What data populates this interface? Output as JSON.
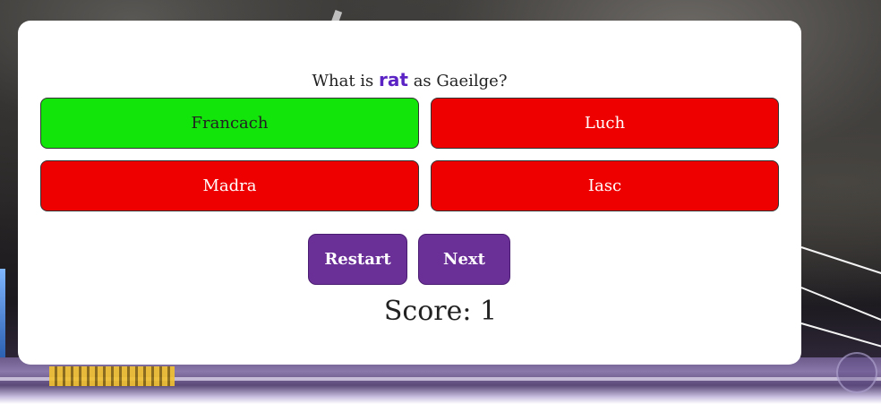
{
  "question": {
    "prefix": "What is",
    "word": "rat",
    "suffix": "as Gaeilge?"
  },
  "answers": [
    {
      "label": "Francach",
      "state": "correct",
      "color": "#12e50a"
    },
    {
      "label": "Luch",
      "state": "incorrect",
      "color": "#ef0000"
    },
    {
      "label": "Madra",
      "state": "incorrect",
      "color": "#ef0000"
    },
    {
      "label": "Iasc",
      "state": "incorrect",
      "color": "#ef0000"
    }
  ],
  "controls": {
    "restart_label": "Restart",
    "next_label": "Next"
  },
  "score": {
    "label": "Score:",
    "value": "1"
  },
  "colors": {
    "accent_purple": "#6a3097",
    "highlight_word": "#5b22c4",
    "correct": "#12e50a",
    "incorrect": "#ef0000"
  }
}
